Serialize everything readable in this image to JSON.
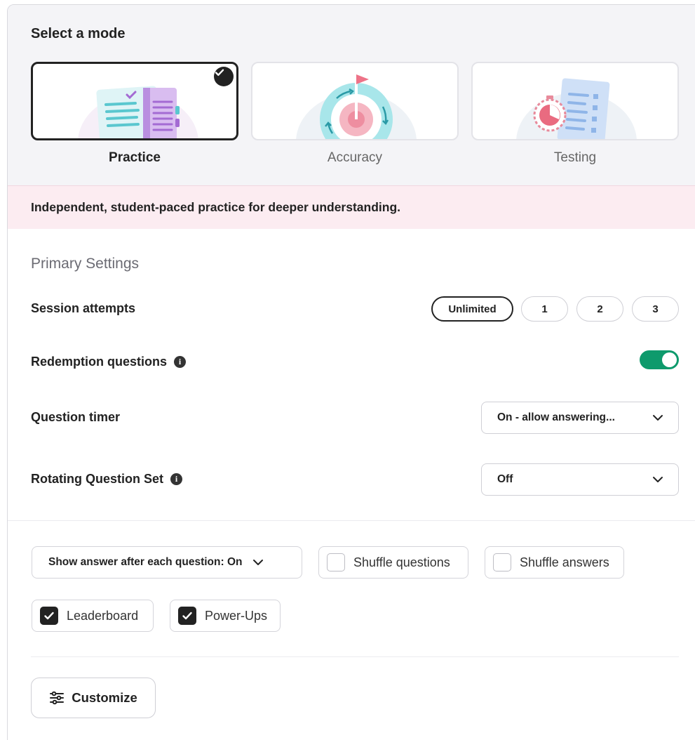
{
  "mode_selector": {
    "title": "Select a mode",
    "modes": [
      {
        "label": "Practice",
        "icon": "practice-notebook-icon",
        "selected": true
      },
      {
        "label": "Accuracy",
        "icon": "accuracy-target-icon",
        "selected": false
      },
      {
        "label": "Testing",
        "icon": "testing-timer-icon",
        "selected": false
      }
    ],
    "description": "Independent, student-paced practice for deeper understanding."
  },
  "primary_settings": {
    "title": "Primary Settings",
    "session_attempts": {
      "label": "Session attempts",
      "options": [
        "Unlimited",
        "1",
        "2",
        "3"
      ],
      "selected": "Unlimited"
    },
    "redemption_questions": {
      "label": "Redemption questions",
      "enabled": true
    },
    "question_timer": {
      "label": "Question timer",
      "value": "On - allow answering..."
    },
    "rotating_question_set": {
      "label": "Rotating Question Set",
      "value": "Off"
    }
  },
  "options": {
    "show_answer": "Show answer after each question: On",
    "shuffle_questions": {
      "label": "Shuffle questions",
      "checked": false
    },
    "shuffle_answers": {
      "label": "Shuffle answers",
      "checked": false
    },
    "leaderboard": {
      "label": "Leaderboard",
      "checked": true
    },
    "power_ups": {
      "label": "Power-Ups",
      "checked": true
    }
  },
  "customize": {
    "label": "Customize"
  },
  "colors": {
    "accent_green": "#0e9a6c",
    "highlight_pink": "#fcecf1",
    "dark": "#222222"
  }
}
